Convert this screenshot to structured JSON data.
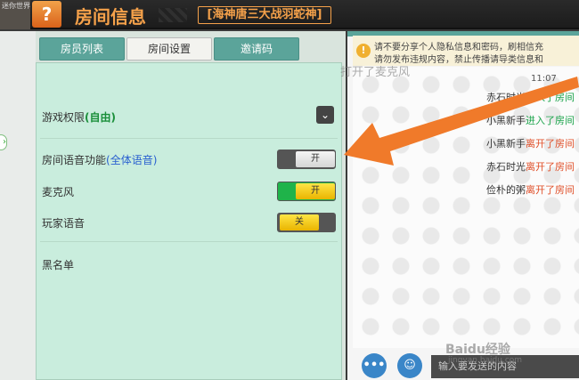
{
  "header": {
    "logo_text": "迷你世界",
    "help_icon": "?",
    "title": "房间信息",
    "room_name": "[海神唐三大战羽蛇神]"
  },
  "tabs": [
    {
      "label": "房员列表",
      "active": false
    },
    {
      "label": "房间设置",
      "active": true
    },
    {
      "label": "邀请码",
      "active": false
    }
  ],
  "settings": {
    "game_permission_label": "游戏权限",
    "game_permission_value": "(自由)",
    "room_voice_label": "房间语音功能",
    "room_voice_value": "(全体语音)",
    "room_voice_toggle": "开",
    "mic_label": "麦克风",
    "mic_toggle": "开",
    "player_voice_label": "玩家语音",
    "player_voice_toggle": "关",
    "blacklist_label": "黑名单"
  },
  "chat": {
    "notice_line1": "请不要分享个人隐私信息和密码，刷相信充",
    "notice_line2": "请勿发布违规内容，禁止传播请导类信息和",
    "time": "11:07",
    "messages": [
      {
        "name": "赤石时光",
        "action": "进入了房间",
        "type": "join"
      },
      {
        "name": "小黑新手",
        "action": "进入了房间",
        "type": "join"
      },
      {
        "name": "小黑新手",
        "action": "离开了房间",
        "type": "leave"
      },
      {
        "name": "赤石时光",
        "action": "离开了房间",
        "type": "leave"
      },
      {
        "name": "俭朴的粥",
        "action": "离开了房间",
        "type": "leave"
      }
    ],
    "input_placeholder": "输入要发送的内容"
  },
  "toast": "打开了麦克风",
  "watermark": "Baidu经验",
  "watermark_sub": "jingyan.baidu.com",
  "colors": {
    "accent_orange": "#f5a14a",
    "teal": "#5ba49a",
    "join_green": "#1aa34a",
    "leave_red": "#e0502a",
    "arrow": "#f07a2a"
  }
}
